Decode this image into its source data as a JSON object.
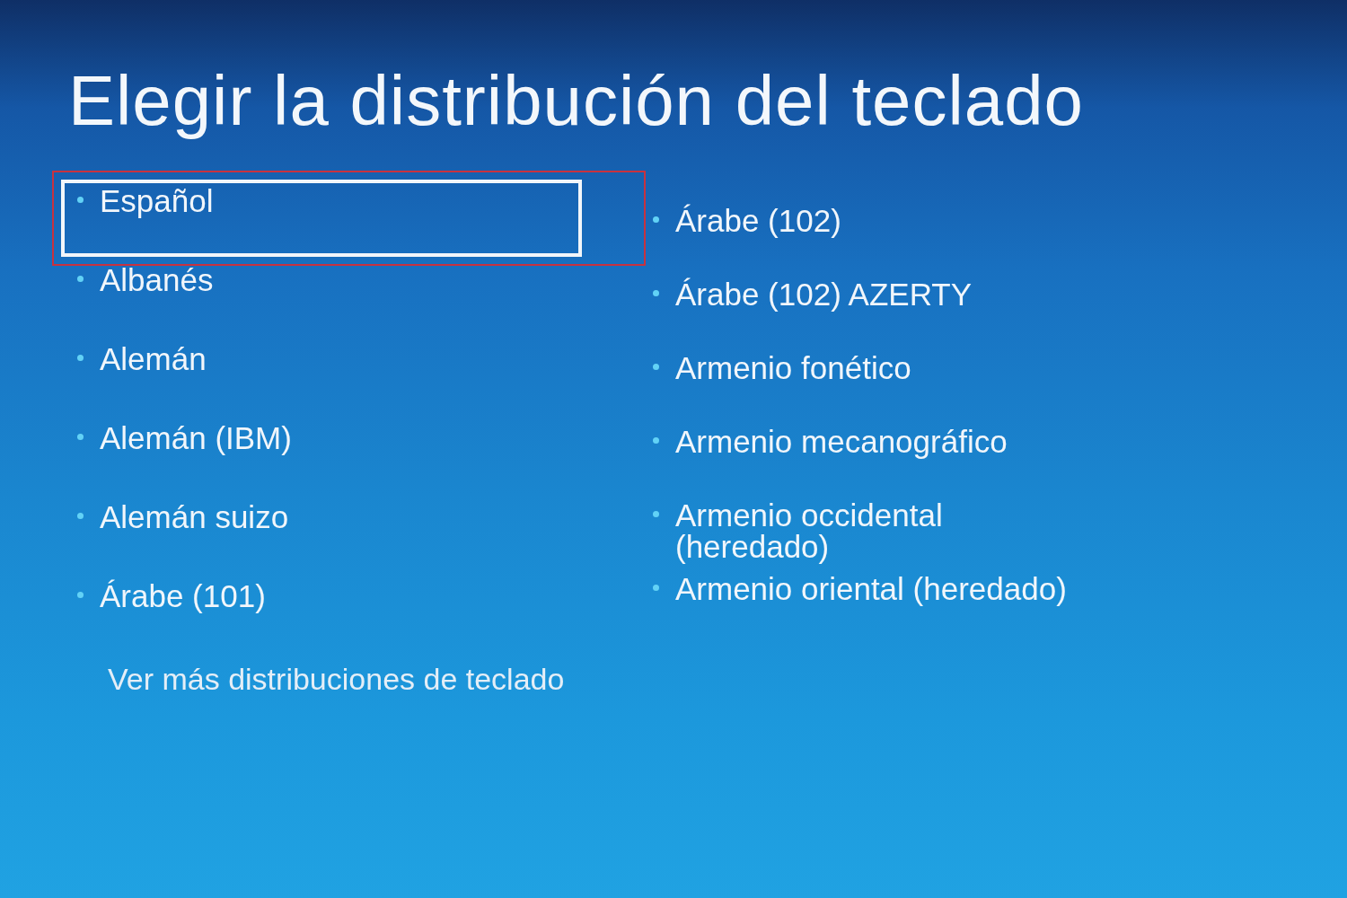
{
  "title": "Elegir la distribución del teclado",
  "left_column": [
    {
      "label": "Español",
      "selected": true,
      "highlighted": true
    },
    {
      "label": "Albanés",
      "selected": false,
      "highlighted": false
    },
    {
      "label": "Alemán",
      "selected": false,
      "highlighted": false
    },
    {
      "label": "Alemán (IBM)",
      "selected": false,
      "highlighted": false
    },
    {
      "label": "Alemán suizo",
      "selected": false,
      "highlighted": false
    },
    {
      "label": "Árabe (101)",
      "selected": false,
      "highlighted": false
    }
  ],
  "more_link": {
    "label": "Ver más distribuciones de teclado"
  },
  "right_column": [
    {
      "label": "Árabe (102)",
      "selected": false,
      "highlighted": false
    },
    {
      "label": "Árabe (102) AZERTY",
      "selected": false,
      "highlighted": false
    },
    {
      "label": "Armenio fonético",
      "selected": false,
      "highlighted": false
    },
    {
      "label": "Armenio mecanográfico",
      "selected": false,
      "highlighted": false
    },
    {
      "label": "Armenio occidental (heredado)",
      "selected": false,
      "highlighted": false
    },
    {
      "label": "Armenio oriental (heredado)",
      "selected": false,
      "highlighted": false
    }
  ]
}
